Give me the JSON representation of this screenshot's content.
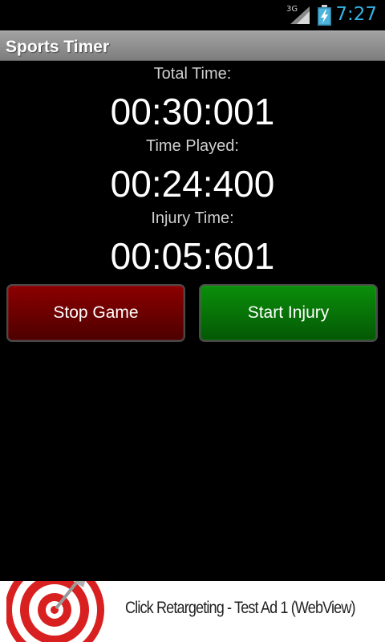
{
  "status_bar": {
    "network": "3G",
    "clock": "7:27",
    "clock_color": "#33b5e5"
  },
  "title_bar": {
    "title": "Sports Timer"
  },
  "timers": {
    "total_label": "Total Time:",
    "total_value": "00:30:001",
    "played_label": "Time Played:",
    "played_value": "00:24:400",
    "injury_label": "Injury Time:",
    "injury_value": "00:05:601"
  },
  "buttons": {
    "stop_game": "Stop Game",
    "stop_color": "#7a0000",
    "start_injury": "Start Injury",
    "injury_color": "#067806"
  },
  "ad": {
    "text": "Click Retargeting - Test Ad 1 (WebView)",
    "icon": "target-icon"
  }
}
